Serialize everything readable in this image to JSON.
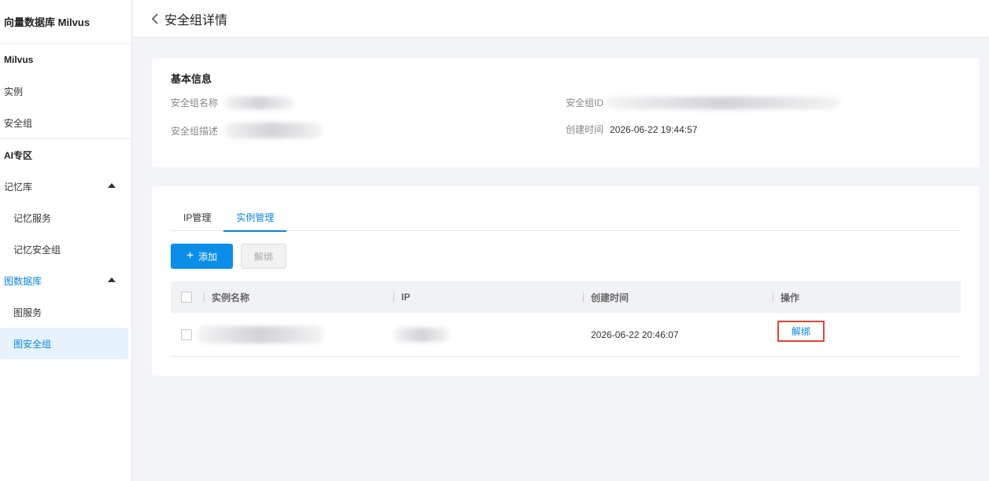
{
  "sidebar": {
    "title": "向量数据库 Milvus",
    "groups": [
      {
        "label": "Milvus"
      },
      {
        "label": "AI专区"
      }
    ],
    "items": {
      "instances": "实例",
      "security_group": "安全组",
      "memory_lib": "记忆库",
      "memory_service": "记忆服务",
      "memory_security_group": "记忆安全组",
      "graph_db": "图数据库",
      "graph_service": "图服务",
      "graph_security_group": "图安全组"
    }
  },
  "header": {
    "title": "安全组详情"
  },
  "basic_info": {
    "title": "基本信息",
    "name_label": "安全组名称",
    "desc_label": "安全组描述",
    "id_label": "安全组ID",
    "created_label": "创建时间",
    "created_value": "2026-06-22 19:44:57"
  },
  "tabs": [
    {
      "label": "IP管理"
    },
    {
      "label": "实例管理"
    }
  ],
  "toolbar": {
    "add_label": "添加",
    "unbind_label": "解绑"
  },
  "table": {
    "columns": [
      "实例名称",
      "IP",
      "创建时间",
      "操作"
    ],
    "rows": [
      {
        "created": "2026-06-22 20:46:07",
        "action": "解绑"
      }
    ]
  }
}
